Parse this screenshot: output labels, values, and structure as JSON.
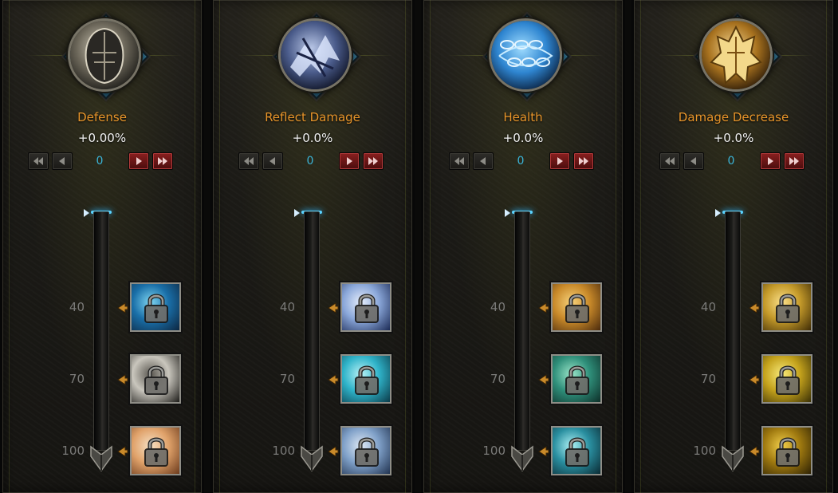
{
  "panels": [
    {
      "title": "Defense",
      "value": "+0.00%",
      "counter": "0",
      "orb_icon": "helmet-icon",
      "orb_colors": [
        "#cfc9b8",
        "#6b6659",
        "#1d1c18"
      ],
      "levels": [
        "40",
        "70",
        "100"
      ],
      "skills": [
        {
          "icon": "ice-sword-lock-icon",
          "colors": [
            "#1a6fa8",
            "#7ed6f2",
            "#0c2640"
          ]
        },
        {
          "icon": "moon-lock-icon",
          "colors": [
            "#c9c6bd",
            "#5a5750",
            "#1c1b18"
          ]
        },
        {
          "icon": "fire-lock-icon",
          "colors": [
            "#e0a26a",
            "#f6e1c4",
            "#6b3a1c"
          ]
        }
      ]
    },
    {
      "title": "Reflect Damage",
      "value": "+0.0%",
      "counter": "0",
      "orb_icon": "dragon-icon",
      "orb_colors": [
        "#b8c6e6",
        "#4a5b8a",
        "#0f1426"
      ],
      "levels": [
        "40",
        "70",
        "100"
      ],
      "skills": [
        {
          "icon": "storm-lock-icon",
          "colors": [
            "#8aa7d9",
            "#e6eefc",
            "#1b2a55"
          ]
        },
        {
          "icon": "crystal-lock-icon",
          "colors": [
            "#2fb3c9",
            "#b9f2f6",
            "#0b3a48"
          ]
        },
        {
          "icon": "wing-lock-icon",
          "colors": [
            "#7fa0c8",
            "#dfe9f5",
            "#213350"
          ]
        }
      ]
    },
    {
      "title": "Health",
      "value": "+0.0%",
      "counter": "0",
      "orb_icon": "chain-orb-icon",
      "orb_colors": [
        "#9fdcff",
        "#2f86d1",
        "#0b2342"
      ],
      "levels": [
        "40",
        "70",
        "100"
      ],
      "skills": [
        {
          "icon": "gold-crest-lock-icon",
          "colors": [
            "#c98a2a",
            "#f7d27a",
            "#4a2a0c"
          ]
        },
        {
          "icon": "green-rune-lock-icon",
          "colors": [
            "#2f8f7a",
            "#9be6c9",
            "#0d2e28"
          ]
        },
        {
          "icon": "teal-spark-lock-icon",
          "colors": [
            "#2a8fa0",
            "#aef3f6",
            "#0a2a33"
          ]
        }
      ]
    },
    {
      "title": "Damage Decrease",
      "value": "+0.0%",
      "counter": "0",
      "orb_icon": "golden-armor-icon",
      "orb_colors": [
        "#f0d28c",
        "#a8721f",
        "#2e1c08"
      ],
      "levels": [
        "40",
        "70",
        "100"
      ],
      "skills": [
        {
          "icon": "sun-shield-lock-icon",
          "colors": [
            "#c49a2a",
            "#fbe08a",
            "#3f2c06"
          ]
        },
        {
          "icon": "hand-lock-icon",
          "colors": [
            "#c4a21c",
            "#f8ea7a",
            "#3a3006"
          ]
        },
        {
          "icon": "hex-gold-lock-icon",
          "colors": [
            "#a07a10",
            "#f2cf4a",
            "#2e2204"
          ]
        }
      ]
    }
  ]
}
